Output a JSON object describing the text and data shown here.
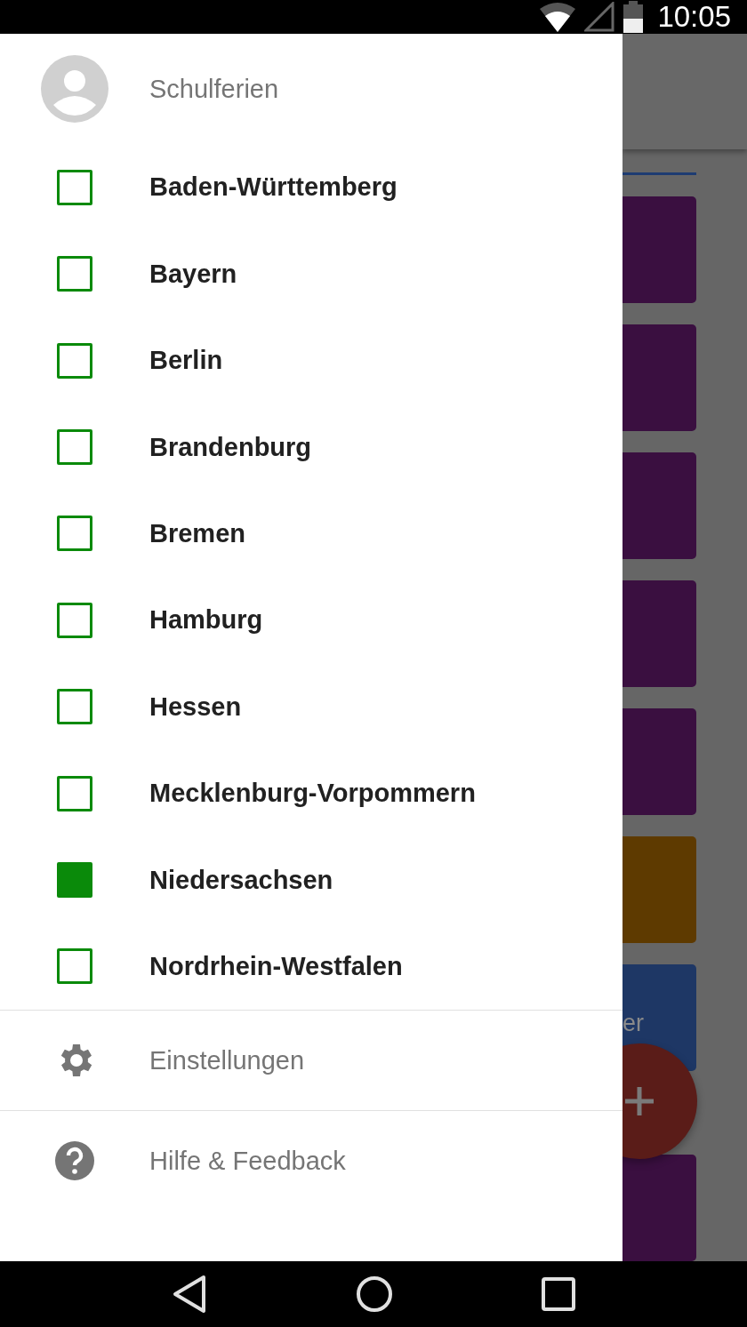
{
  "status_bar": {
    "time": "10:05"
  },
  "drawer": {
    "title": "Schulferien",
    "states": [
      {
        "label": "Baden-Württemberg",
        "checked": false
      },
      {
        "label": "Bayern",
        "checked": false
      },
      {
        "label": "Berlin",
        "checked": false
      },
      {
        "label": "Brandenburg",
        "checked": false
      },
      {
        "label": "Bremen",
        "checked": false
      },
      {
        "label": "Hamburg",
        "checked": false
      },
      {
        "label": "Hessen",
        "checked": false
      },
      {
        "label": "Mecklenburg-Vorpommern",
        "checked": false
      },
      {
        "label": "Niedersachsen",
        "checked": true
      },
      {
        "label": "Nordrhein-Westfalen",
        "checked": false
      }
    ],
    "footer": [
      {
        "kind": "settings",
        "label": "Einstellungen"
      },
      {
        "kind": "help",
        "label": "Hilfe & Feedback"
      }
    ]
  },
  "background_cards": [
    {
      "color": "#3a0f40"
    },
    {
      "color": "#3a0f40"
    },
    {
      "color": "#3a0f40"
    },
    {
      "color": "#3a0f40"
    },
    {
      "color": "#3a0f40"
    },
    {
      "color": "#5e3a00"
    },
    {
      "color": "#1e3765",
      "text": "er"
    },
    {
      "color": "#3a0f40"
    }
  ]
}
